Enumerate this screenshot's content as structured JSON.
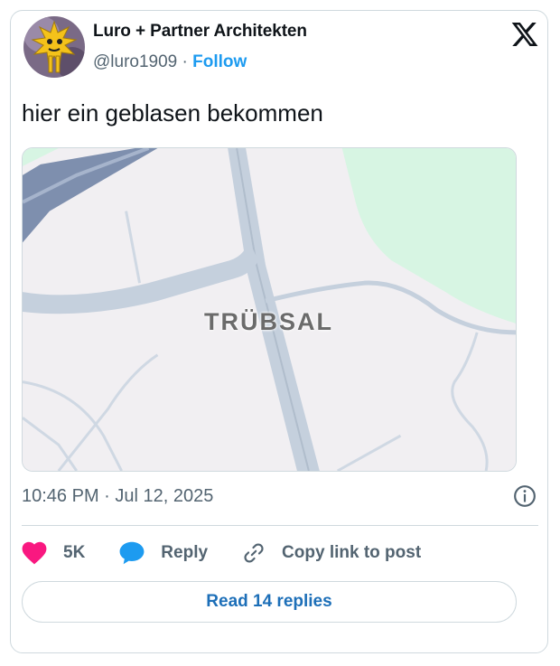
{
  "author": {
    "name": "Luro + Partner Architekten",
    "handle": "@luro1909",
    "separator": "·",
    "follow_label": "Follow"
  },
  "tweet": {
    "text": "hier ein geblasen bekommen",
    "image": {
      "map_label": "TRÜBSAL"
    }
  },
  "meta": {
    "time": "10:46 PM",
    "separator": "·",
    "date": "Jul 12, 2025"
  },
  "actions": {
    "likes": "5K",
    "reply_label": "Reply",
    "copy_label": "Copy link to post"
  },
  "read_replies_label": "Read 14 replies",
  "colors": {
    "accent": "#1d9bf0",
    "like": "#f91880",
    "text_secondary": "#536471",
    "border": "#cfd9de"
  },
  "icons": {
    "logo": "x-logo-icon",
    "info": "info-icon",
    "like": "heart-icon",
    "reply": "speech-bubble-icon",
    "copy": "link-icon"
  }
}
